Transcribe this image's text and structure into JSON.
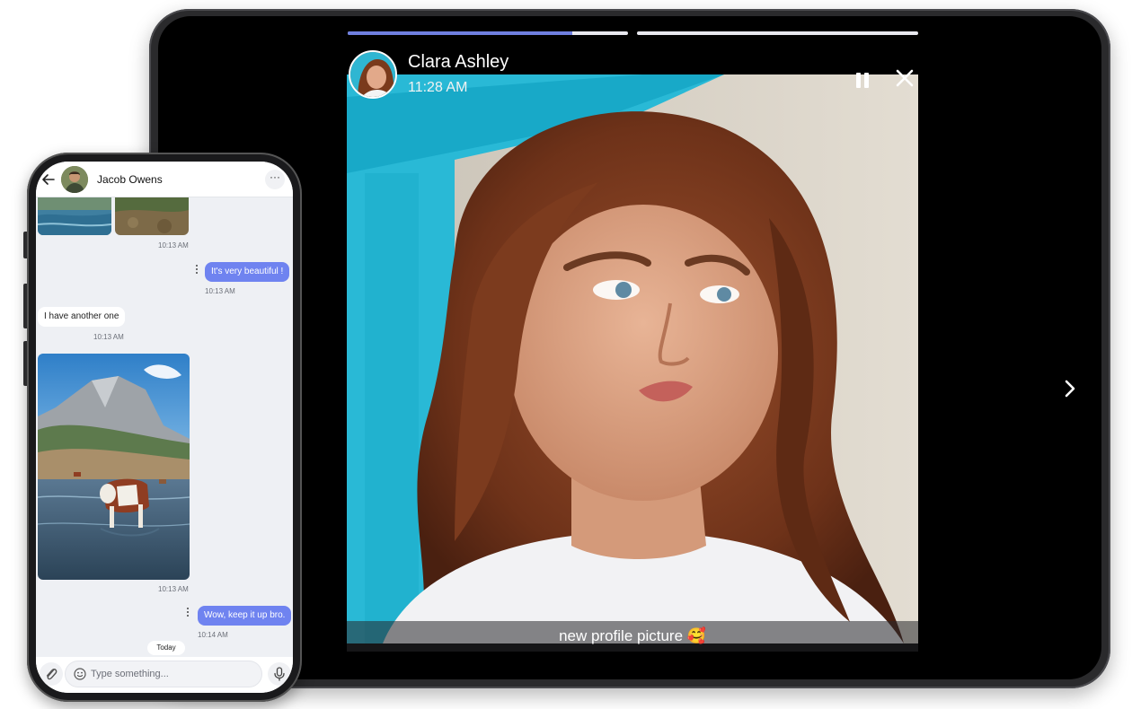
{
  "tablet": {
    "story": {
      "user_name": "Clara Ashley",
      "time": "11:28 AM",
      "caption": "new profile picture 🥰",
      "progress": [
        0.8,
        0.0
      ],
      "icons": {
        "pause": "pause-icon",
        "close": "close-icon",
        "next": "chevron-right-icon"
      },
      "colors": {
        "progress_fill": "#6f7fe0",
        "progress_track": "#e8e8ee"
      }
    }
  },
  "phone": {
    "header": {
      "contact_name": "Jacob Owens",
      "back_icon": "arrow-left-icon",
      "more_label": "···"
    },
    "messages": [
      {
        "type": "image-pair",
        "direction": "in",
        "time": "10:13 AM"
      },
      {
        "type": "text",
        "direction": "out",
        "text": "It's very beautiful !",
        "time": "10:13 AM"
      },
      {
        "type": "text",
        "direction": "in",
        "text": "I have another one",
        "time": "10:13 AM"
      },
      {
        "type": "image",
        "direction": "in",
        "time": "10:13 AM"
      },
      {
        "type": "text",
        "direction": "out",
        "text": "Wow, keep it up bro.",
        "time": "10:14 AM"
      }
    ],
    "day_divider": "Today",
    "composer": {
      "placeholder": "Type something...",
      "attach_icon": "paperclip-icon",
      "emoji_icon": "smiley-icon",
      "mic_icon": "microphone-icon"
    },
    "colors": {
      "outgoing_bubble": "#6f83f0",
      "incoming_bubble": "#ffffff",
      "chat_bg": "#eef0f4"
    }
  }
}
